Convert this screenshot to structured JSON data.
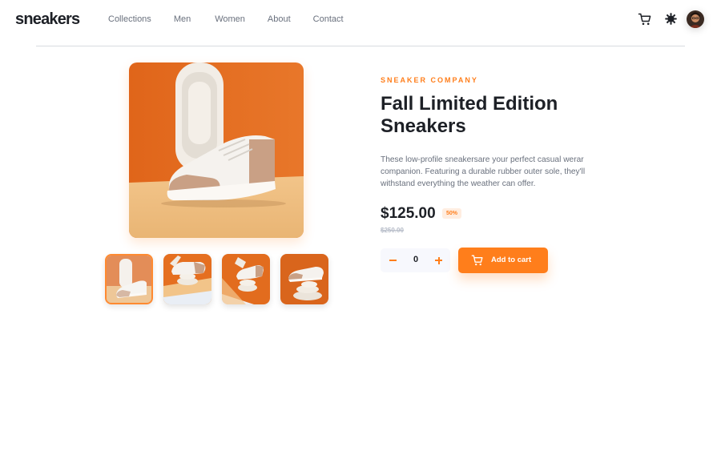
{
  "header": {
    "logo": "sneakers",
    "nav": [
      "Collections",
      "Men",
      "Women",
      "About",
      "Contact"
    ],
    "icons": {
      "cart": "cart-icon",
      "theme": "sun-gear-icon",
      "avatar": "avatar"
    }
  },
  "product": {
    "company": "SNEAKER COMPANY",
    "title": "Fall Limited Edition Sneakers",
    "description": "These low-profile sneakersare your perfect casual werar companion. Featuring a durable rubber outer sole, they'll withstand everything the weather can offer.",
    "price": "$125.00",
    "discount": "50%",
    "old_price": "$250.00",
    "quantity": "0",
    "add_to_cart": "Add to cart",
    "selected_thumbnail": 1
  },
  "colors": {
    "accent": "#ff7e1b",
    "accent_pale": "#ffede0",
    "text_dark": "#1d2026",
    "text_gray": "#69707d",
    "muted": "#b6bcc8",
    "qty_bg": "#f7f8fd"
  }
}
